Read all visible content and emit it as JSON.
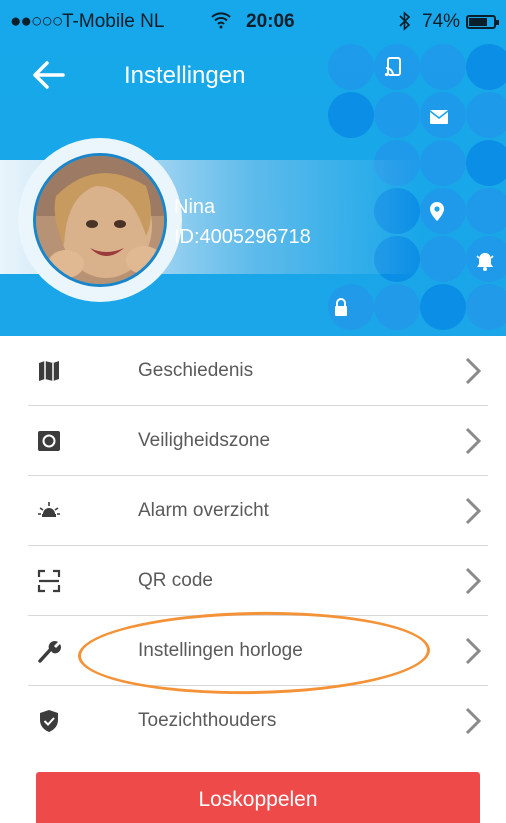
{
  "status_bar": {
    "signal": "●●○○○",
    "carrier": "T-Mobile NL",
    "time": "20:06",
    "battery": "74%",
    "battery_level": 0.74
  },
  "header": {
    "title": "Instellingen",
    "back_icon": "arrow-left-icon",
    "bg_color": "#1aa6e8"
  },
  "profile": {
    "name": "Nina",
    "id": "ID:4005296718"
  },
  "menu": {
    "items": [
      {
        "label": "Geschiedenis",
        "icon": "map-icon"
      },
      {
        "label": "Veiligheidszone",
        "icon": "safe-zone-icon"
      },
      {
        "label": "Alarm overzicht",
        "icon": "alarm-light-icon"
      },
      {
        "label": "QR code",
        "icon": "qr-scan-icon"
      },
      {
        "label": "Instellingen horloge",
        "icon": "wrench-icon"
      },
      {
        "label": "Toezichthouders",
        "icon": "shield-icon"
      }
    ]
  },
  "disconnect_button": {
    "label": "Loskoppelen",
    "color": "#ee4a4a"
  },
  "annotation": {
    "color": "#f39237"
  }
}
